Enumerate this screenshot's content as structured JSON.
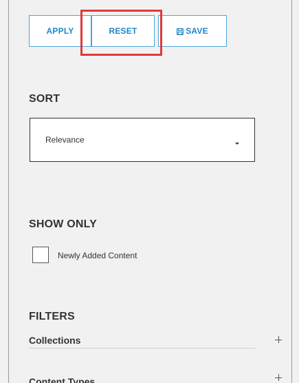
{
  "toolbar": {
    "apply_label": "APPLY",
    "reset_label": "RESET",
    "save_label": "SAVE",
    "save_icon": "save-icon",
    "highlight_color": "#e0393b",
    "button_color": "#1f86c6"
  },
  "sort": {
    "heading": "SORT",
    "selected": "Relevance"
  },
  "show_only": {
    "heading": "SHOW ONLY",
    "checkbox_label": "Newly Added Content",
    "checked": false
  },
  "filters": {
    "heading": "FILTERS",
    "items": [
      {
        "label": "Collections",
        "icon": "plus-icon"
      },
      {
        "label": "Content Types",
        "icon": "plus-icon"
      }
    ]
  }
}
